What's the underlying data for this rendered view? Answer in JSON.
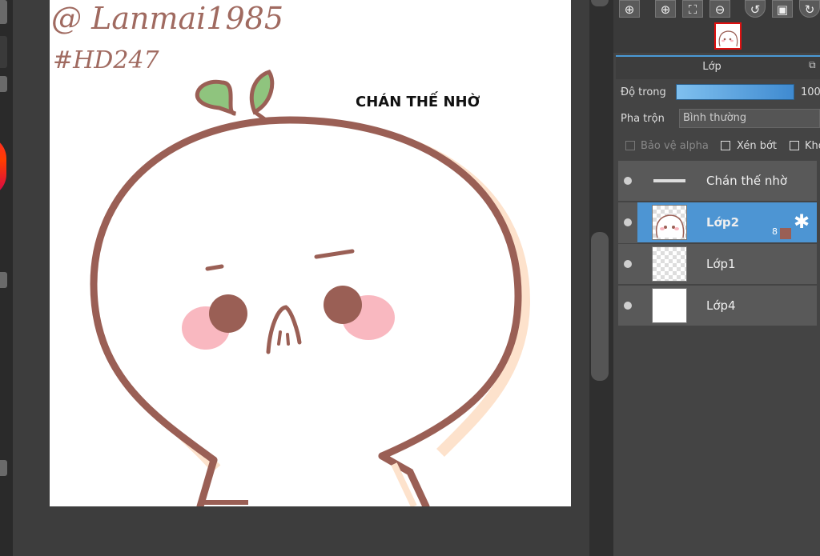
{
  "canvas": {
    "signature_line1": "@ Lanmai1985",
    "signature_line2": "#HD247",
    "caption": "CHÁN THẾ NHỜ"
  },
  "toolbar": {
    "buttons": [
      {
        "icon": "zoom-actual-icon"
      },
      {
        "icon": "zoom-in-icon"
      },
      {
        "icon": "fit-screen-icon"
      },
      {
        "icon": "zoom-out-icon"
      },
      {
        "icon": "rotate-left-icon"
      },
      {
        "icon": "fullscreen-icon"
      },
      {
        "icon": "rotate-right-icon"
      }
    ]
  },
  "layer_panel": {
    "title": "Lớp",
    "opacity_label": "Độ trong",
    "opacity_value": "100",
    "blend_label": "Pha trộn",
    "blend_value": "Bình thường",
    "protect_alpha_label": "Bảo vệ alpha",
    "clipping_label": "Xén bớt",
    "lock_label": "Khó",
    "layers": [
      {
        "name": "Chán thế nhờ",
        "selected": false,
        "thumb": "text"
      },
      {
        "name": "Lớp2",
        "selected": true,
        "thumb": "drawing",
        "badge": "8"
      },
      {
        "name": "Lớp1",
        "selected": false,
        "thumb": "checker"
      },
      {
        "name": "Lớp4",
        "selected": false,
        "thumb": "white"
      }
    ]
  },
  "colors": {
    "accent": "#4d95d3",
    "line_brown": "#9a5f55",
    "blush_pink": "#f9b8c0",
    "leaf_green": "#8fc47e",
    "shadow_peach": "#fde2cc"
  }
}
